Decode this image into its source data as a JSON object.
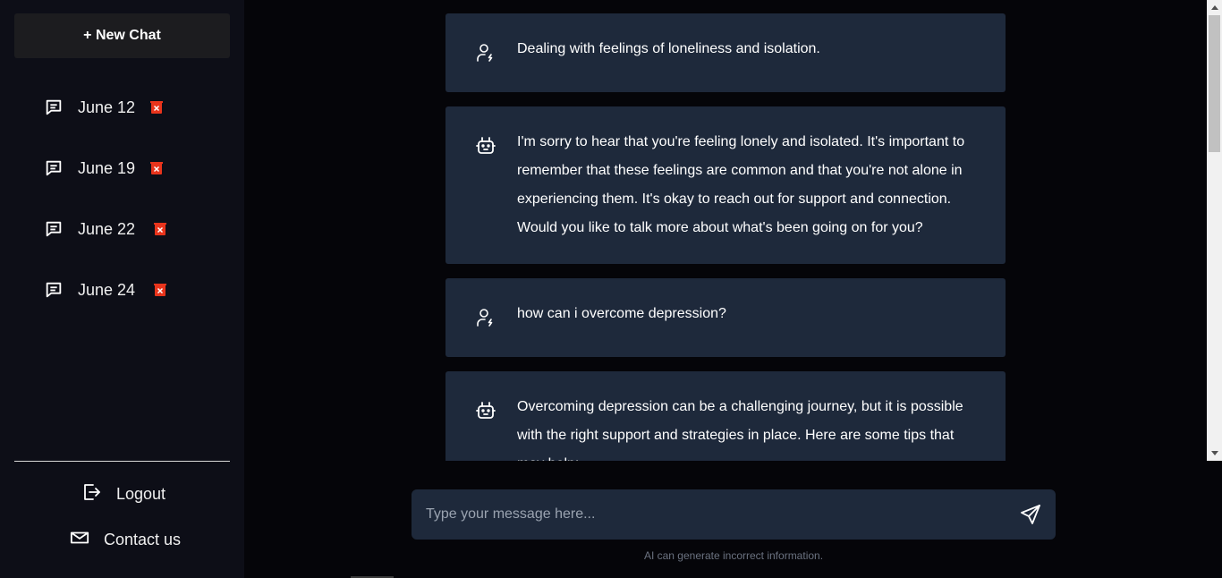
{
  "sidebar": {
    "new_chat_label": "+ New Chat",
    "chats": [
      {
        "label": "June 12"
      },
      {
        "label": "June 19"
      },
      {
        "label": "June 22"
      },
      {
        "label": "June 24"
      }
    ],
    "logout_label": "Logout",
    "contact_label": "Contact us"
  },
  "messages": [
    {
      "role": "user",
      "text": "Dealing with feelings of loneliness and isolation."
    },
    {
      "role": "bot",
      "text": "I'm sorry to hear that you're feeling lonely and isolated. It's important to remember that these feelings are common and that you're not alone in experiencing them. It's okay to reach out for support and connection. Would you like to talk more about what's been going on for you?"
    },
    {
      "role": "user",
      "text": "how can i overcome depression?"
    },
    {
      "role": "bot",
      "text": "Overcoming depression can be a challenging journey, but it is possible with the right support and strategies in place. Here are some tips that may help:"
    }
  ],
  "input": {
    "placeholder": "Type your message here...",
    "value": ""
  },
  "disclaimer": "AI can generate incorrect information.",
  "colors": {
    "accent_trash": "#e8341c",
    "message_bg": "#1e293b",
    "sidebar_bg": "#0d0e17"
  }
}
